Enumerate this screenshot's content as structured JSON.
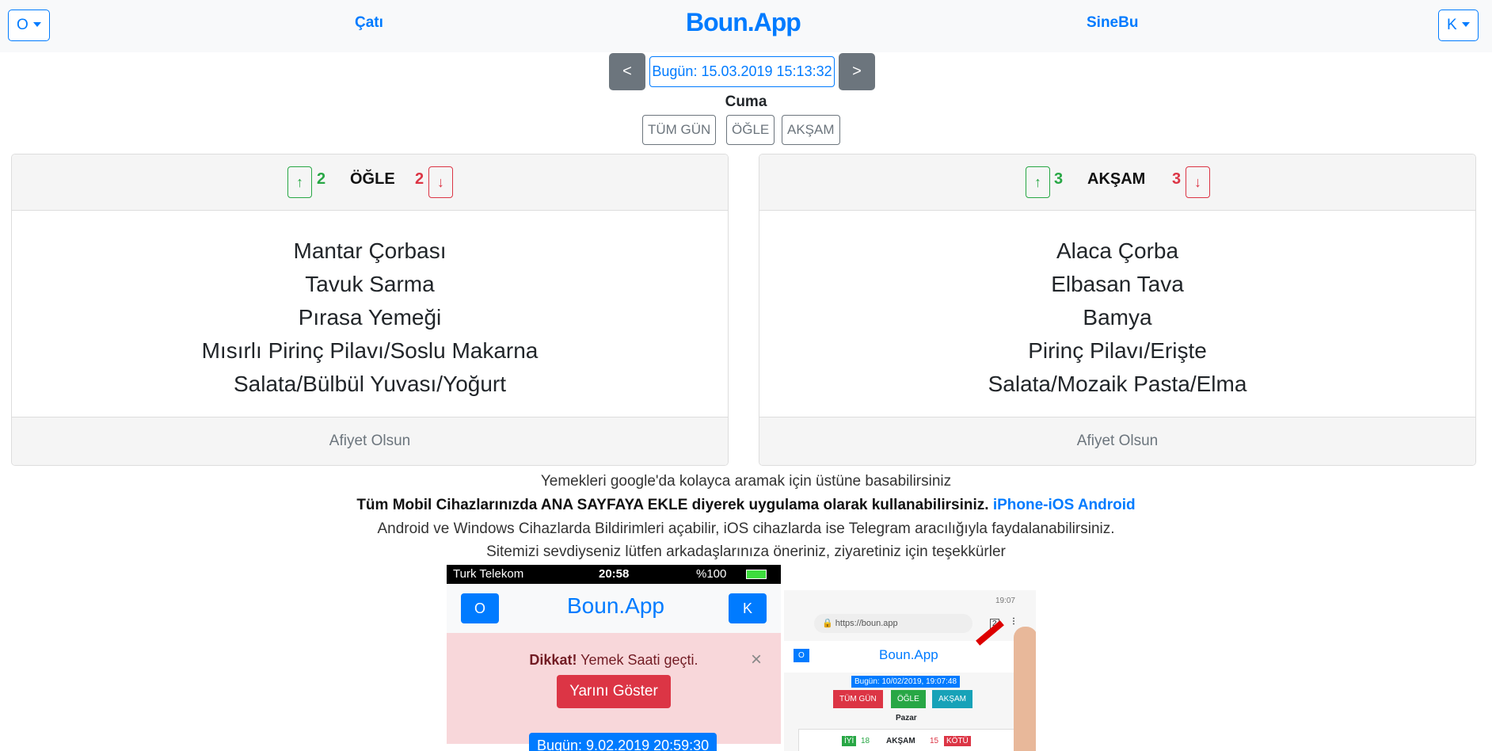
{
  "nav": {
    "left_dropdown": "O",
    "link_left": "Çatı",
    "brand": "Boun.App",
    "link_right": "SineBu",
    "right_dropdown": "K"
  },
  "date": {
    "prev": "<",
    "next": ">",
    "today": "Bugün: 15.03.2019 15:13:32",
    "day": "Cuma"
  },
  "filters": [
    "TÜM GÜN",
    "ÖĞLE",
    "AKŞAM"
  ],
  "meals": [
    {
      "title": "ÖĞLE",
      "up_icon": "↑",
      "up": "2",
      "down": "2",
      "down_icon": "↓",
      "items": [
        "Mantar Çorbası",
        "Tavuk Sarma",
        "Pırasa Yemeği",
        "Mısırlı Pirinç Pilavı/Soslu Makarna",
        "Salata/Bülbül Yuvası/Yoğurt"
      ],
      "footer": "Afiyet Olsun"
    },
    {
      "title": "AKŞAM",
      "up_icon": "↑",
      "up": "3",
      "down": "3",
      "down_icon": "↓",
      "items": [
        "Alaca Çorba",
        "Elbasan Tava",
        "Bamya",
        "Pirinç Pilavı/Erişte",
        "Salata/Mozaik Pasta/Elma"
      ],
      "footer": "Afiyet Olsun"
    }
  ],
  "info": {
    "line1": "Yemekleri google'da kolayca aramak için üstüne basabilirsiniz",
    "line2": "Tüm Mobil Cihazlarınızda ANA SAYFAYA EKLE diyerek uygulama olarak kullanabilirsiniz.",
    "link_ios": "iPhone-iOS",
    "link_android": "Android",
    "line3": "Android ve Windows Cihazlarda Bildirimleri açabilir, iOS cihazlarda ise Telegram aracılığıyla faydalanabilirsiniz.",
    "line4": "Sitemizi sevdiyseniz lütfen arkadaşlarınıza öneriniz, ziyaretiniz için teşekkürler"
  },
  "shot1": {
    "carrier": "Turk Telekom",
    "time": "20:58",
    "battery": "%100",
    "o": "O",
    "k": "K",
    "brand": "Boun.App",
    "alert_bold": "Dikkat!",
    "alert": "Yemek Saati geçti.",
    "close": "×",
    "button": "Yarını Göster",
    "date": "Bugün: 9.02.2019 20:59:30"
  },
  "shot2": {
    "time": "19:07",
    "url": "https://boun.app",
    "tabs": "2",
    "o": "O",
    "brand": "Boun.App",
    "date": "Bugün: 10/02/2019, 19:07:48",
    "b1": "TÜM GÜN",
    "b2": "ÖĞLE",
    "b3": "AKŞAM",
    "day": "Pazar",
    "iyi": "İYİ",
    "up": "18",
    "title": "AKŞAM",
    "down": "15",
    "kotu": "KÖTÜ"
  },
  "colors": {
    "primary": "#007bff",
    "success": "#28a745",
    "danger": "#dc3545",
    "secondary": "#6c757d"
  }
}
